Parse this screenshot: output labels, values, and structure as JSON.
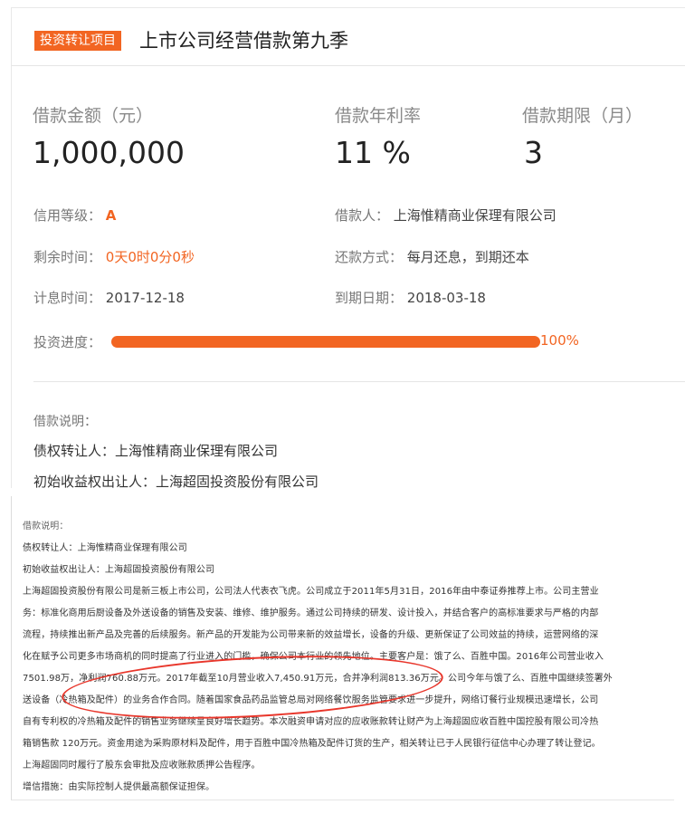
{
  "header": {
    "tag": "投资转让项目",
    "title": "上市公司经营借款第九季"
  },
  "summary": {
    "amount_label": "借款金额（元）",
    "amount_value": "1,000,000",
    "rate_label": "借款年利率",
    "rate_value": "11 %",
    "term_label": "借款期限（月）",
    "term_value": "3"
  },
  "details": {
    "credit_label": "信用等级：",
    "credit_value": "A",
    "borrower_label": "借款人：",
    "borrower_value": "上海惟精商业保理有限公司",
    "remaining_label": "剩余时间：",
    "remaining_value": "0天0时0分0秒",
    "repay_label": "还款方式：",
    "repay_value": "每月还息，到期还本",
    "interest_label": "计息时间：",
    "interest_value": "2017-12-18",
    "due_label": "到期日期：",
    "due_value": "2018-03-18",
    "progress_label": "投资进度：",
    "progress_percent": 100,
    "progress_text": "100%"
  },
  "description": {
    "title": "借款说明：",
    "transferor": "债权转让人：上海惟精商业保理有限公司",
    "initial": "初始收益权出让人：上海超固投资股份有限公司"
  },
  "document": {
    "lines": [
      "借款说明：",
      "债权转让人：上海惟精商业保理有限公司",
      "初始收益权出让人：上海超固投资股份有限公司",
      "上海超固投资股份有限公司是新三板上市公司，公司法人代表衣飞虎。公司成立于2011年5月31日，2016年由中泰证券推荐上市。公司主营业",
      "务：标准化商用后厨设备及外送设备的销售及安装、维修、维护服务。通过公司持续的研发、设计投入，并结合客户的高标准要求与严格的内部",
      "流程，持续推出新产品及完善的后续服务。新产品的开发能为公司带来新的效益增长，设备的升级、更新保证了公司效益的持续，运营网络的深",
      "化在赋予公司更多市场商机的同时提高了行业进入的门槛，确保公司本行业的领先地位。主要客户是：饿了么、百胜中国。2016年公司营业收入",
      "7501.98万，净利润760.88万元。2017年截至10月营业收入7,450.91万元，合并净利润813.36万元。公司今年与饿了么、百胜中国继续签署外",
      "送设备（冷热箱及配件）的业务合作合同。随着国家食品药品监管总局对网络餐饮服务监管要求进一步提升，网络订餐行业规模迅速增长，公司",
      "自有专利权的冷热箱及配件的销售业务继续呈良好增长趋势。本次融资申请对应的应收账款转让财产为上海超固应收百胜中国控股有限公司冷热",
      "箱销售款 120万元。资金用途为采购原材料及配件，用于百胜中国冷热箱及配件订货的生产，相关转让已于人民银行征信中心办理了转让登记。",
      "上海超固同时履行了股东会审批及应收账款质押公告程序。",
      "增信措施：由实际控制人提供最高额保证担保。"
    ]
  },
  "colors": {
    "accent": "#f26522",
    "annotation": "#e8362b"
  }
}
